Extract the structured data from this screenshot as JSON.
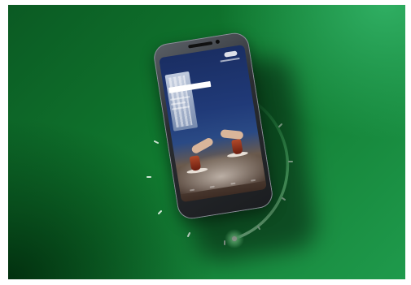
{
  "banner": {
    "background_colors": [
      "#0b5a23",
      "#10792f",
      "#1f9a4c"
    ],
    "accent_glow": "#7dff9e"
  },
  "phone": {
    "icon": "smartphone-icon",
    "screen_scene": "people-with-tea-glasses"
  },
  "arc": {
    "progress": 0.35,
    "icon": "progress-arc"
  }
}
